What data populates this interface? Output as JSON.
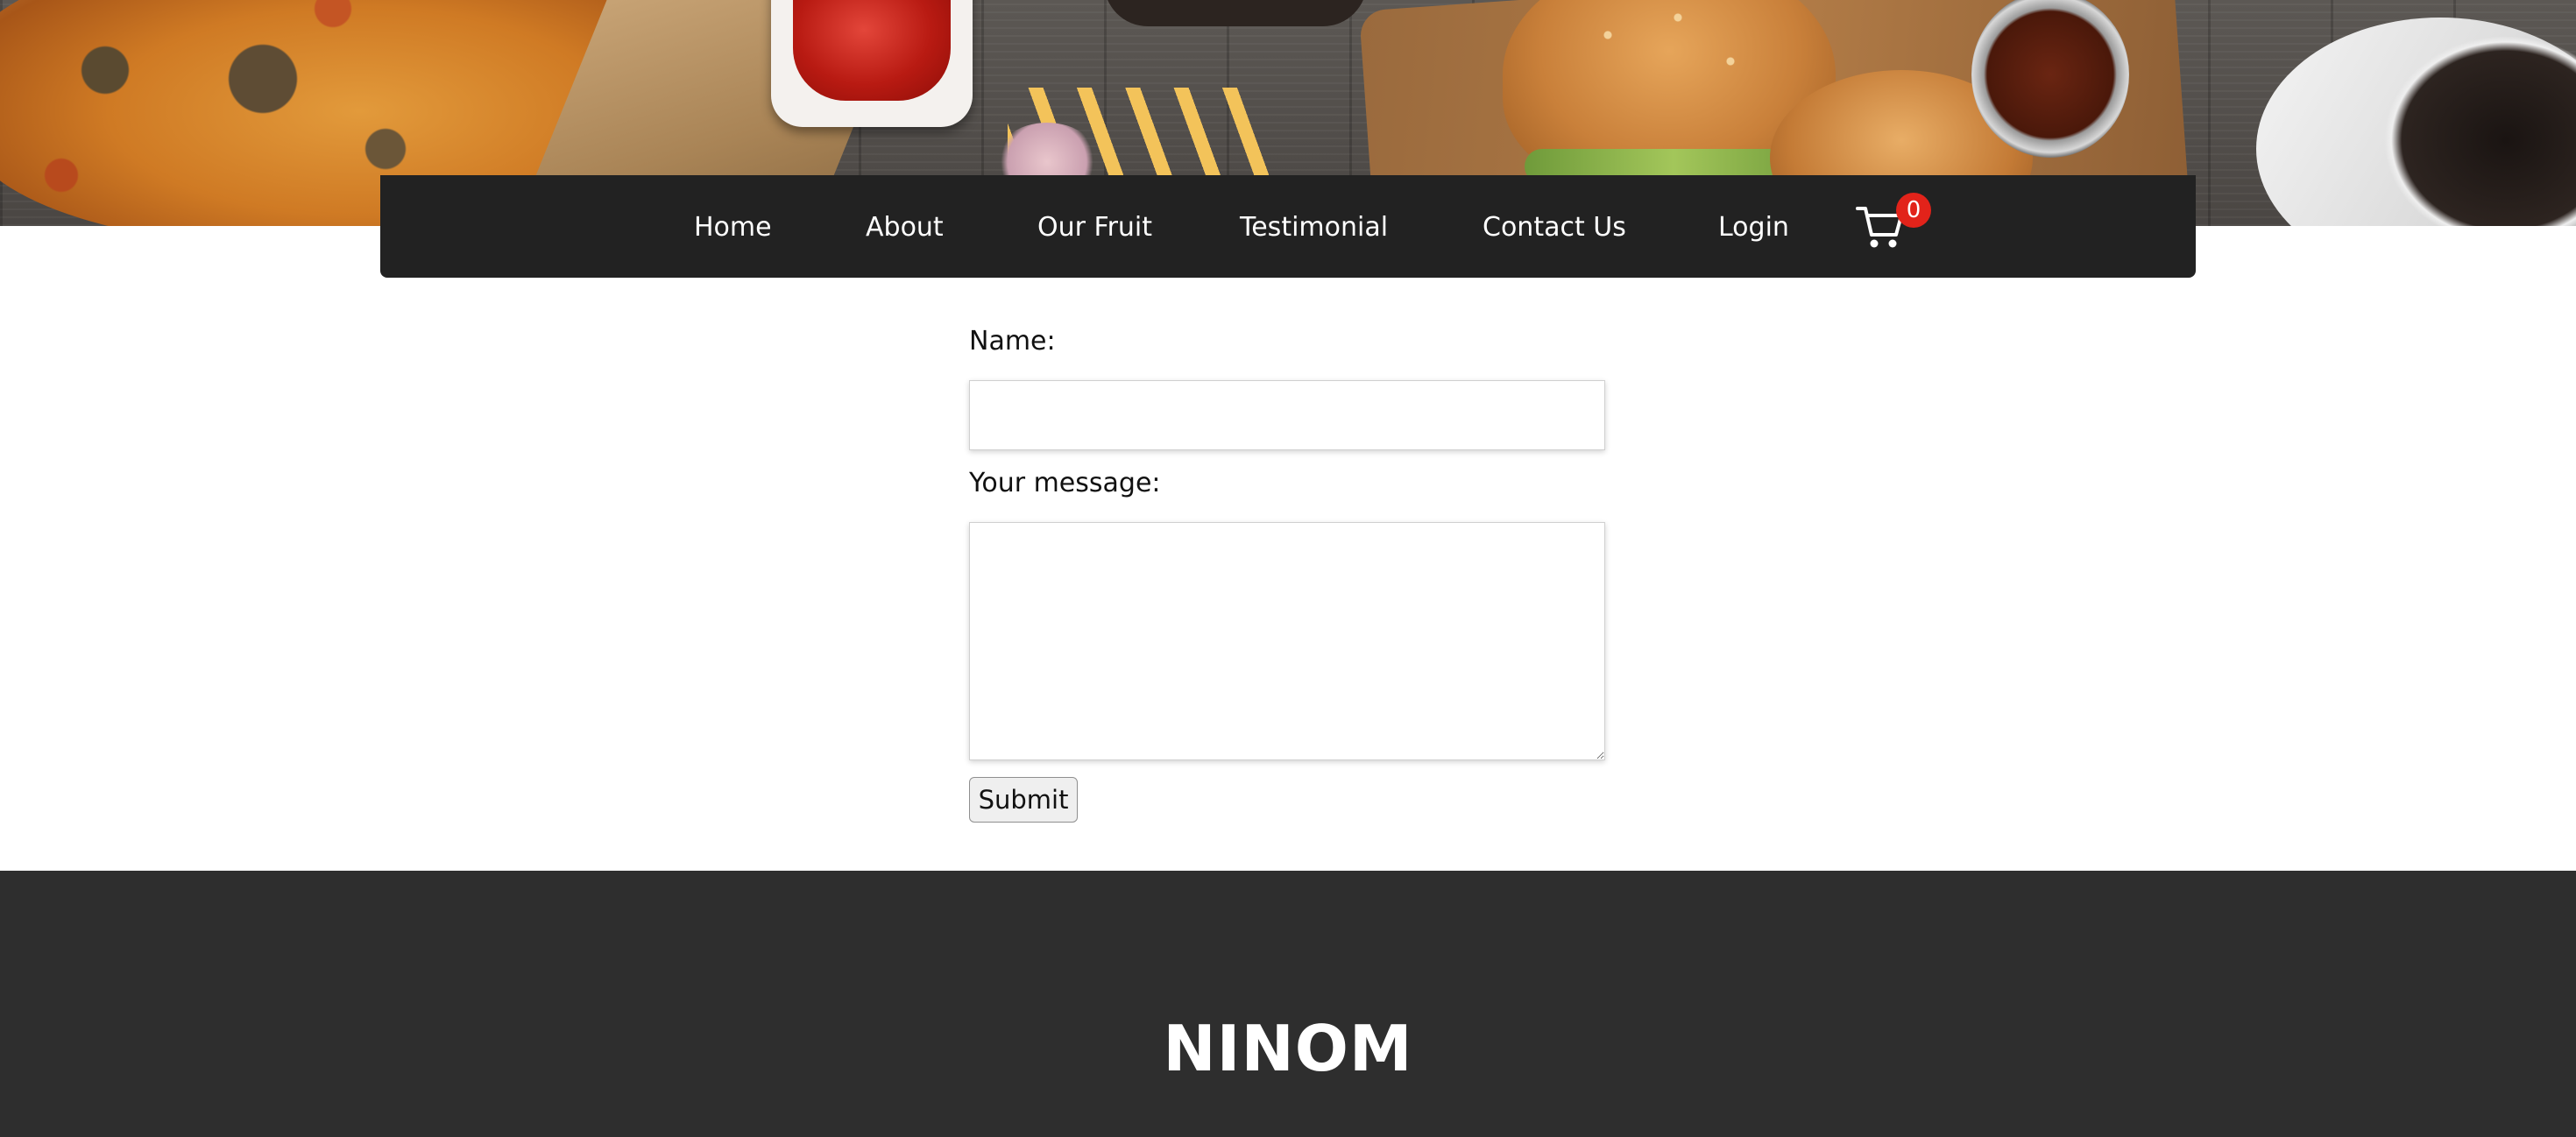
{
  "header": {
    "hero_image": "food-banner-image",
    "nav": {
      "items": [
        {
          "label": "Home"
        },
        {
          "label": "About"
        },
        {
          "label": "Our Fruit"
        },
        {
          "label": "Testimonial"
        },
        {
          "label": "Contact Us"
        },
        {
          "label": "Login"
        }
      ],
      "cart": {
        "icon": "shopping-cart-icon",
        "count": "0",
        "badge_color": "#e2231a"
      }
    }
  },
  "form": {
    "name_label": "Name:",
    "name_value": "",
    "message_label": "Your message:",
    "message_value": "",
    "submit_label": "Submit"
  },
  "footer": {
    "brand": "NINOM"
  },
  "colors": {
    "navbar_bg": "#222222",
    "footer_bg": "#2e2e2e",
    "nav_text": "#ffffff"
  }
}
